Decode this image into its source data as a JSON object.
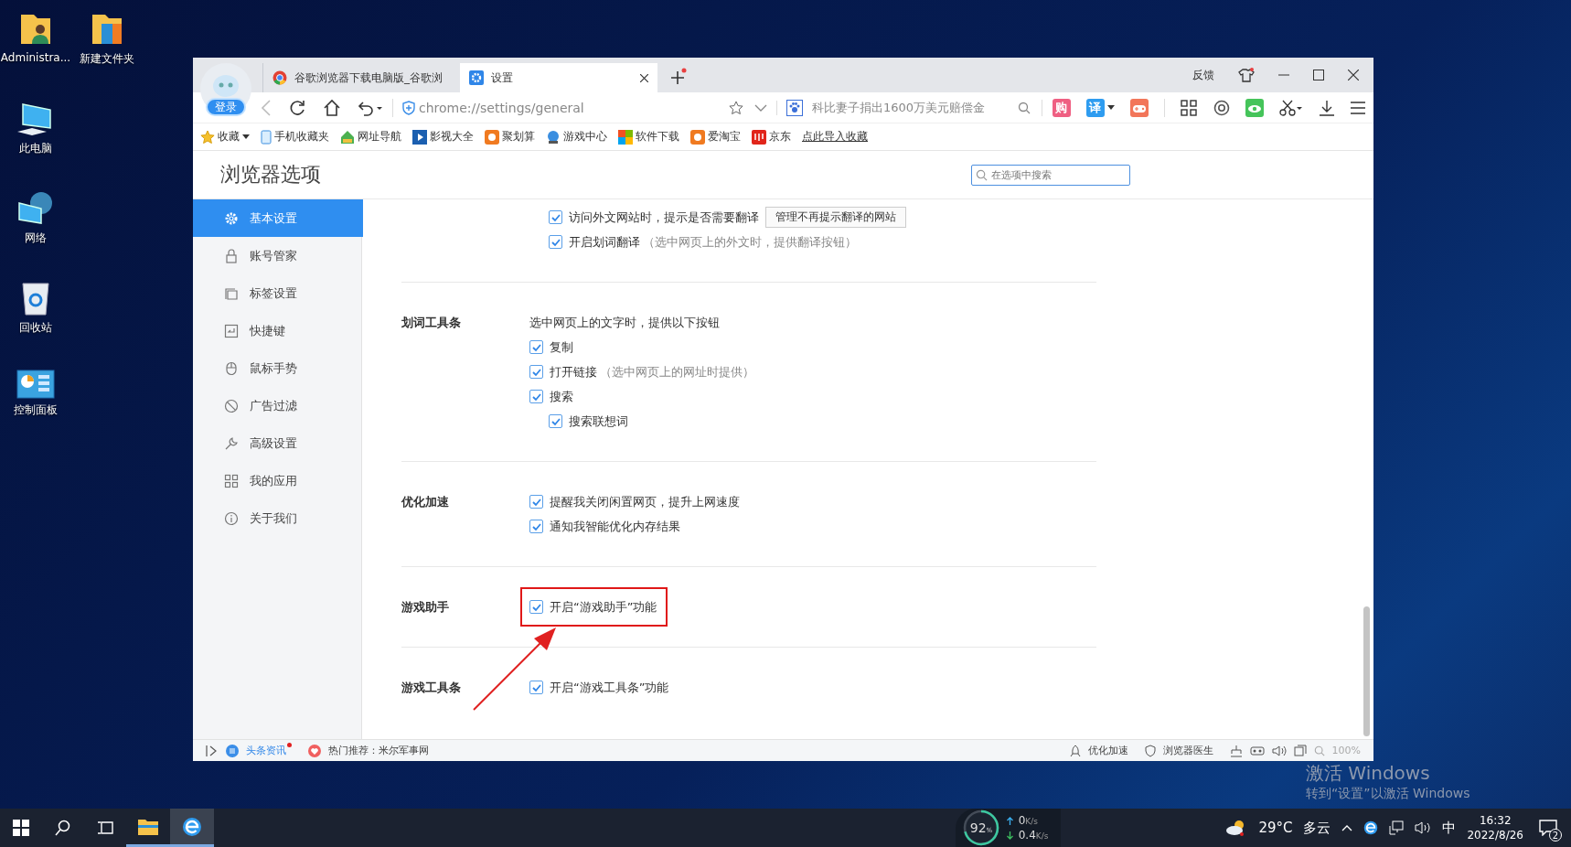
{
  "desktop": {
    "icons": [
      {
        "label": "Administra...",
        "kind": "user-folder"
      },
      {
        "label": "新建文件夹",
        "kind": "folder"
      },
      {
        "label": "此电脑",
        "kind": "computer"
      },
      {
        "label": "网络",
        "kind": "network"
      },
      {
        "label": "回收站",
        "kind": "recycle"
      },
      {
        "label": "控制面板",
        "kind": "control"
      }
    ],
    "activation": {
      "title": "激活 Windows",
      "subtitle": "转到“设置”以激活 Windows"
    }
  },
  "browser": {
    "user_button": "登录",
    "tabs": [
      {
        "title": "谷歌浏览器下载电脑版_谷歌浏",
        "selected": false
      },
      {
        "title": "设置",
        "selected": true
      }
    ],
    "feedback": "反馈",
    "address": "chrome://settings/general",
    "search_value": "科比妻子捐出1600万美元赔偿金",
    "badges": [
      {
        "label": "购",
        "color": "#ef5f82",
        "dropdown": false
      },
      {
        "label": "译",
        "color": "#2e9cf0",
        "dropdown": true
      }
    ],
    "bookmarks": [
      {
        "label": "收藏",
        "kind": "star"
      },
      {
        "label": "手机收藏夹",
        "kind": "phone"
      },
      {
        "label": "网址导航",
        "kind": "home"
      },
      {
        "label": "影视大全",
        "kind": "film"
      },
      {
        "label": "聚划算",
        "kind": "tao"
      },
      {
        "label": "游戏中心",
        "kind": "game"
      },
      {
        "label": "软件下载",
        "kind": "soft"
      },
      {
        "label": "爱淘宝",
        "kind": "tao"
      },
      {
        "label": "京东",
        "kind": "shop"
      },
      {
        "label": "点此导入收藏",
        "kind": "link"
      }
    ]
  },
  "settings": {
    "title": "浏览器选项",
    "search_placeholder": "在选项中搜索",
    "nav": [
      {
        "label": "基本设置",
        "kind": "gear",
        "selected": true
      },
      {
        "label": "账号管家",
        "kind": "lock",
        "selected": false
      },
      {
        "label": "标签设置",
        "kind": "tabs",
        "selected": false
      },
      {
        "label": "快捷键",
        "kind": "key",
        "selected": false
      },
      {
        "label": "鼠标手势",
        "kind": "mouse",
        "selected": false
      },
      {
        "label": "广告过滤",
        "kind": "block",
        "selected": false
      },
      {
        "label": "高级设置",
        "kind": "wrench",
        "selected": false
      },
      {
        "label": "我的应用",
        "kind": "apps",
        "selected": false
      },
      {
        "label": "关于我们",
        "kind": "info",
        "selected": false
      }
    ],
    "sections": [
      {
        "highlighted": false,
        "options": [
          {
            "label": "访问外文网站时，提示是否需要翻译",
            "checked": true,
            "button": "管理不再提示翻译的网站"
          },
          {
            "label": "开启划词翻译",
            "hint": "（选中网页上的外文时，提供翻译按钮）",
            "checked": true
          }
        ]
      },
      {
        "label": "划词工具条",
        "description": "选中网页上的文字时，提供以下按钮",
        "highlighted": false,
        "options": [
          {
            "label": "复制",
            "checked": true
          },
          {
            "label": "打开链接",
            "hint": "（选中网页上的网址时提供）",
            "checked": true
          },
          {
            "label": "搜索",
            "checked": true,
            "children": [
              {
                "label": "搜索联想词",
                "checked": true
              }
            ]
          }
        ]
      },
      {
        "label": "优化加速",
        "highlighted": false,
        "options": [
          {
            "label": "提醒我关闭闲置网页，提升上网速度",
            "checked": true
          },
          {
            "label": "通知我智能优化内存结果",
            "checked": true
          }
        ]
      },
      {
        "label": "游戏助手",
        "highlighted": true,
        "options": [
          {
            "label": "开启“游戏助手”功能",
            "checked": true
          }
        ]
      },
      {
        "label": "游戏工具条",
        "highlighted": false,
        "options": [
          {
            "label": "开启“游戏工具条”功能",
            "checked": true
          }
        ]
      }
    ]
  },
  "status_bar": {
    "news": "头条资讯",
    "news_unread": true,
    "hot": "热门推荐：米尔军事网",
    "speedup": "优化加速",
    "doctor": "浏览器医生",
    "zoom": "100%"
  },
  "taskbar": {
    "apps": [
      {
        "kind": "explorer",
        "selected": false
      },
      {
        "kind": "browser",
        "selected": true
      }
    ],
    "monitor": {
      "percent": "92",
      "unit": "%",
      "up": "0",
      "down": "0.4",
      "up_unit": "K/s",
      "down_unit": "K/s"
    },
    "tray": {
      "temperature": "29°C",
      "weather": "多云",
      "ime": "中",
      "time": "16:32",
      "date": "2022/8/26",
      "notifications": "2"
    }
  }
}
